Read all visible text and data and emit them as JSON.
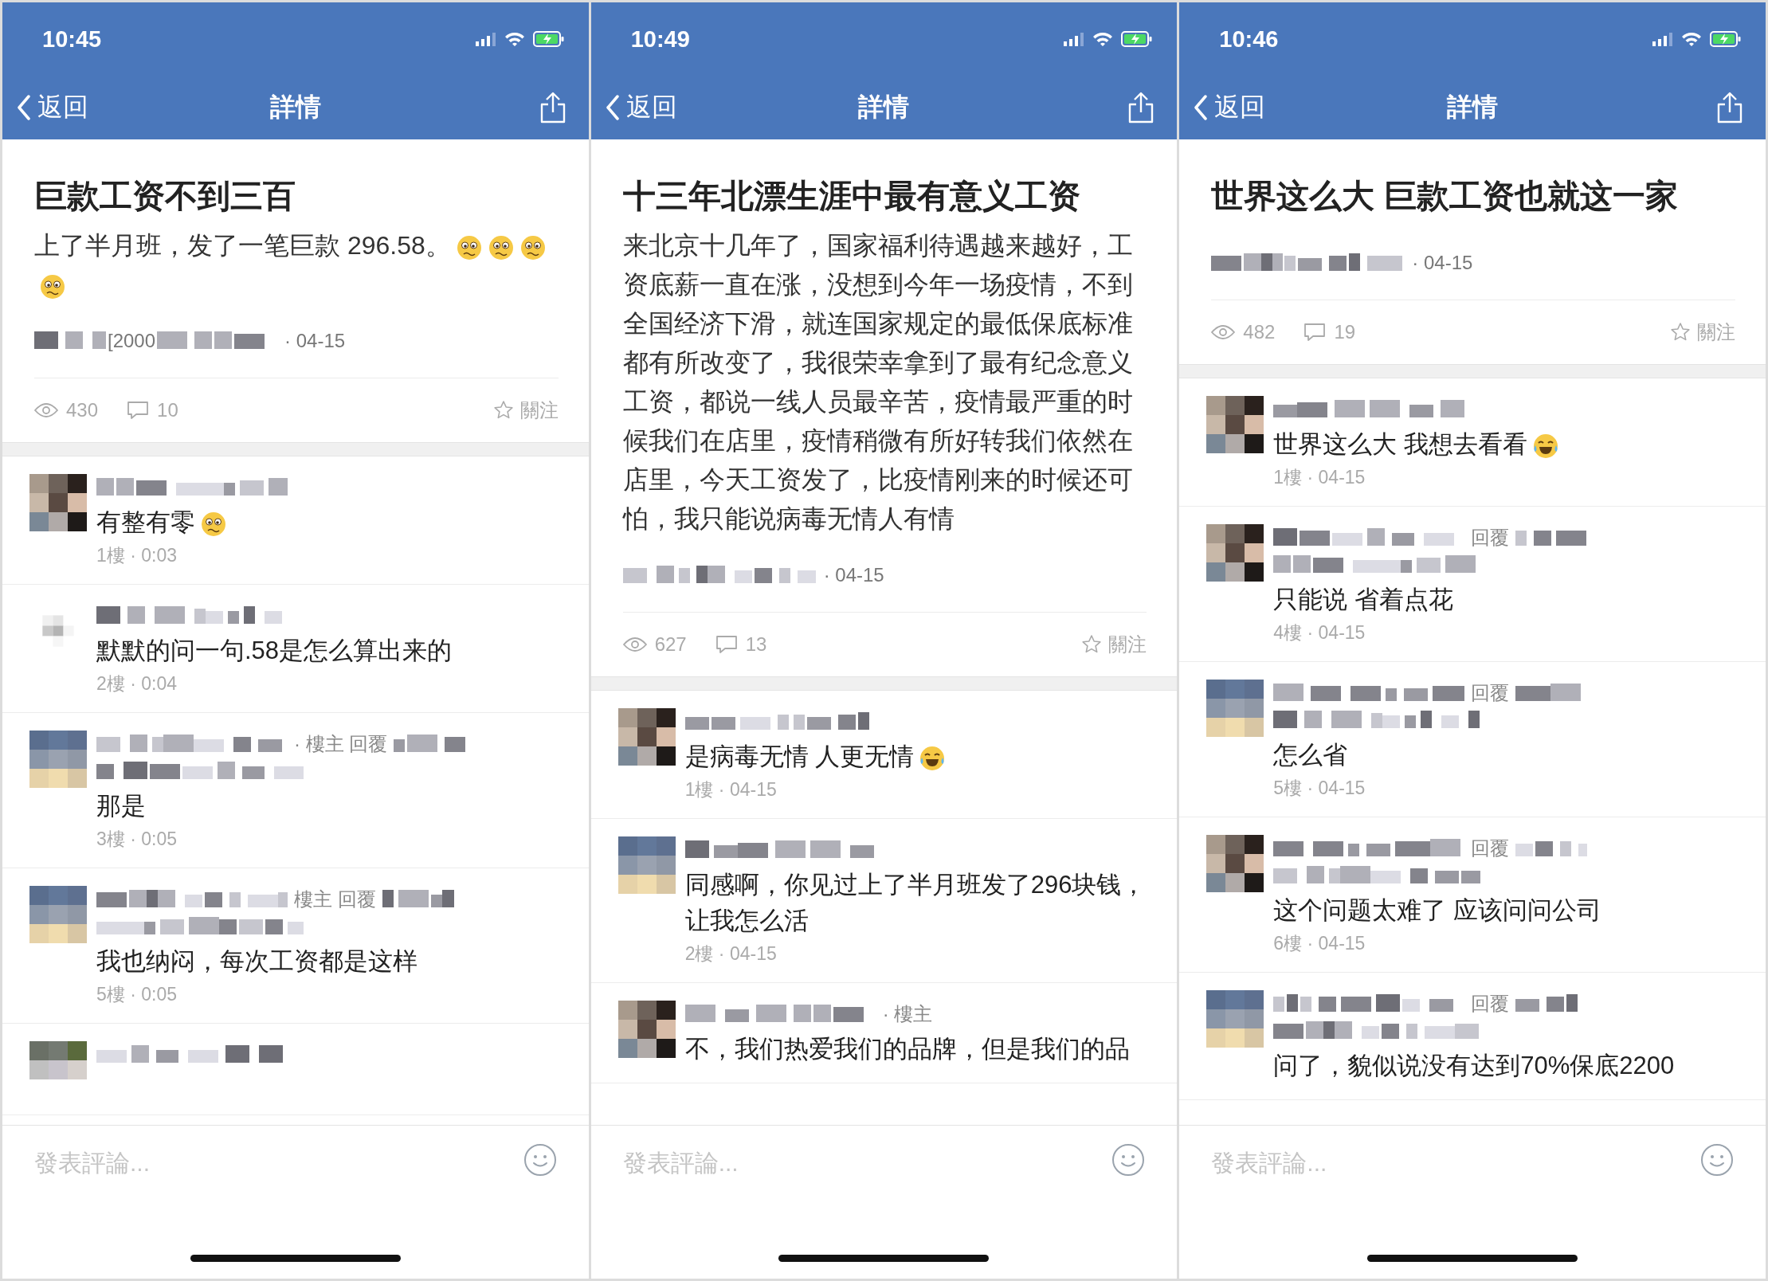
{
  "panels": [
    {
      "status": {
        "time": "10:45"
      },
      "nav": {
        "back": "返回",
        "title": "詳情"
      },
      "post": {
        "title": "巨款工资不到三百",
        "body": "上了半月班，发了一笔巨款 296.58。",
        "body_emojis": [
          {
            "kind": "worried"
          },
          {
            "kind": "worried"
          },
          {
            "kind": "worried"
          },
          {
            "kind": "worried"
          }
        ],
        "author_fragment": "[2000",
        "date": "· 04-15",
        "views": "430",
        "comment_count": "10",
        "follow": "關注"
      },
      "comments": [
        {
          "reply_target": false,
          "name_wraps": false,
          "text": "有整有零",
          "emoji": {
            "kind": "worried"
          },
          "meta": "1樓 · 0:03"
        },
        {
          "avatar": {
            "kind": "plain"
          },
          "reply_target": false,
          "name_wraps": false,
          "text": "默默的问一句.58是怎么算出来的",
          "meta": "2樓 · 0:04"
        },
        {
          "avatar": {
            "kind": "landscape"
          },
          "tag": "· 樓主 回覆",
          "reply_target": true,
          "name_wraps": true,
          "text": "那是",
          "meta": "3樓 · 0:05"
        },
        {
          "avatar": {
            "kind": "landscape"
          },
          "tag": "樓主 回覆",
          "reply_target": true,
          "name_wraps": true,
          "text": "我也纳闷，每次工资都是这样",
          "meta": "5樓 · 0:05"
        },
        {
          "avatar": {
            "kind": "green"
          },
          "reply_target": false
        }
      ],
      "composer": {
        "placeholder": "發表評論..."
      }
    },
    {
      "status": {
        "time": "10:49"
      },
      "nav": {
        "back": "返回",
        "title": "詳情"
      },
      "post": {
        "title": "十三年北漂生涯中最有意义工资",
        "body": "来北京十几年了，国家福利待遇越来越好，工资底薪一直在涨，没想到今年一场疫情，不到全国经济下滑，就连国家规定的最低保底标准都有所改变了，我很荣幸拿到了最有纪念意义工资，都说一线人员最辛苦，疫情最严重的时候我们在店里，疫情稍微有所好转我们依然在店里，今天工资发了，比疫情刚来的时候还可怕，我只能说病毒无情人有情",
        "date": "· 04-15",
        "views": "627",
        "comment_count": "13",
        "follow": "關注"
      },
      "comments": [
        {
          "reply_target": false,
          "name_wraps": false,
          "text": "是病毒无情 人更无情",
          "emoji": {
            "kind": "laughing"
          },
          "meta": "1樓 · 04-15"
        },
        {
          "avatar": {
            "kind": "landscape"
          },
          "reply_target": false,
          "name_wraps": false,
          "text": "同感啊，你见过上了半月班发了296块钱，让我怎么活",
          "meta": "2樓 · 04-15"
        },
        {
          "tag": "· 樓主",
          "reply_target": false,
          "name_wraps": false,
          "text": "不，我们热爱我们的品牌，但是我们的品"
        }
      ],
      "composer": {
        "placeholder": "發表評論..."
      }
    },
    {
      "status": {
        "time": "10:46"
      },
      "nav": {
        "back": "返回",
        "title": "詳情"
      },
      "post": {
        "title": "世界这么大 巨款工资也就这一家",
        "date": "· 04-15",
        "views": "482",
        "comment_count": "19",
        "follow": "關注"
      },
      "comments": [
        {
          "reply_target": false,
          "name_wraps": false,
          "text": "世界这么大 我想去看看",
          "emoji": {
            "kind": "laughing"
          },
          "meta": "1樓 · 04-15"
        },
        {
          "tag": "回覆",
          "reply_target": true,
          "name_wraps": true,
          "text": "只能说 省着点花",
          "meta": "4樓 · 04-15"
        },
        {
          "avatar": {
            "kind": "landscape"
          },
          "tag": "回覆",
          "reply_target": true,
          "name_wraps": true,
          "text": "怎么省",
          "meta": "5樓 · 04-15"
        },
        {
          "tag": "回覆",
          "reply_target": true,
          "name_wraps": true,
          "text": "这个问题太难了 应该问问公司",
          "meta": "6樓 · 04-15"
        },
        {
          "avatar": {
            "kind": "landscape"
          },
          "tag": "回覆",
          "reply_target": true,
          "name_wraps": true,
          "text": "问了，貌似说没有达到70%保底2200"
        }
      ],
      "composer": {
        "placeholder": "發表評論..."
      }
    }
  ]
}
